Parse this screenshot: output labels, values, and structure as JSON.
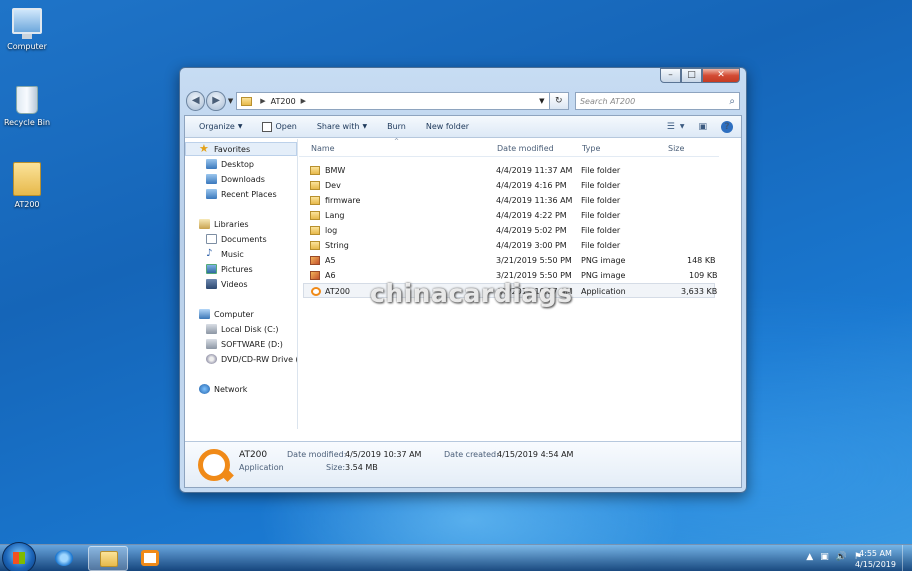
{
  "desktop": {
    "icons": [
      {
        "label": "Computer"
      },
      {
        "label": "Recycle Bin"
      },
      {
        "label": "AT200"
      }
    ]
  },
  "window": {
    "controls": {
      "minimize": "–",
      "maximize": "□",
      "close": "✕"
    },
    "address": {
      "path": "AT200",
      "back": "◀",
      "forward": "▶",
      "refresh": "↻"
    },
    "search": {
      "placeholder": "Search AT200"
    },
    "toolbar": {
      "organize": "Organize",
      "open": "Open",
      "share_with": "Share with",
      "burn": "Burn",
      "new_folder": "New folder",
      "help": "?"
    },
    "navigation": {
      "favorites": "Favorites",
      "desktop": "Desktop",
      "downloads": "Downloads",
      "recent_places": "Recent Places",
      "libraries": "Libraries",
      "documents": "Documents",
      "music": "Music",
      "pictures": "Pictures",
      "videos": "Videos",
      "computer": "Computer",
      "local_disk": "Local Disk (C:)",
      "software": "SOFTWARE (D:)",
      "dvd": "DVD/CD-RW Drive (",
      "network": "Network"
    },
    "columns": {
      "name": "Name",
      "date_modified": "Date modified",
      "type": "Type",
      "size": "Size"
    },
    "files": [
      {
        "name": "BMW",
        "date": "4/4/2019 11:37 AM",
        "type": "File folder",
        "size": "",
        "icon": "folder-icon"
      },
      {
        "name": "Dev",
        "date": "4/4/2019 4:16 PM",
        "type": "File folder",
        "size": "",
        "icon": "folder-icon"
      },
      {
        "name": "firmware",
        "date": "4/4/2019 11:36 AM",
        "type": "File folder",
        "size": "",
        "icon": "folder-icon"
      },
      {
        "name": "Lang",
        "date": "4/4/2019 4:22 PM",
        "type": "File folder",
        "size": "",
        "icon": "folder-icon"
      },
      {
        "name": "log",
        "date": "4/4/2019 5:02 PM",
        "type": "File folder",
        "size": "",
        "icon": "folder-icon"
      },
      {
        "name": "String",
        "date": "4/4/2019 3:00 PM",
        "type": "File folder",
        "size": "",
        "icon": "folder-icon"
      },
      {
        "name": "A5",
        "date": "3/21/2019 5:50 PM",
        "type": "PNG image",
        "size": "148 KB",
        "icon": "png-image-icon"
      },
      {
        "name": "A6",
        "date": "3/21/2019 5:50 PM",
        "type": "PNG image",
        "size": "109 KB",
        "icon": "png-image-icon"
      },
      {
        "name": "AT200",
        "date": "4/5/2019 10:37 AM",
        "type": "Application",
        "size": "3,633 KB",
        "icon": "application-icon"
      }
    ],
    "details": {
      "name": "AT200",
      "kind": "Application",
      "date_modified_label": "Date modified:",
      "date_modified": "4/5/2019 10:37 AM",
      "size_label": "Size:",
      "size": "3.54 MB",
      "date_created_label": "Date created:",
      "date_created": "4/15/2019 4:54 AM"
    }
  },
  "watermark": "chinacardiags",
  "taskbar": {
    "clock_time": "4:55 AM",
    "clock_date": "4/15/2019",
    "tray_icons": [
      "▲",
      "▣",
      "🔊",
      "⚑"
    ]
  },
  "colors": {
    "accent": "#1565b8",
    "selection": "#f1f4f8",
    "app_orange": "#f08a18"
  }
}
